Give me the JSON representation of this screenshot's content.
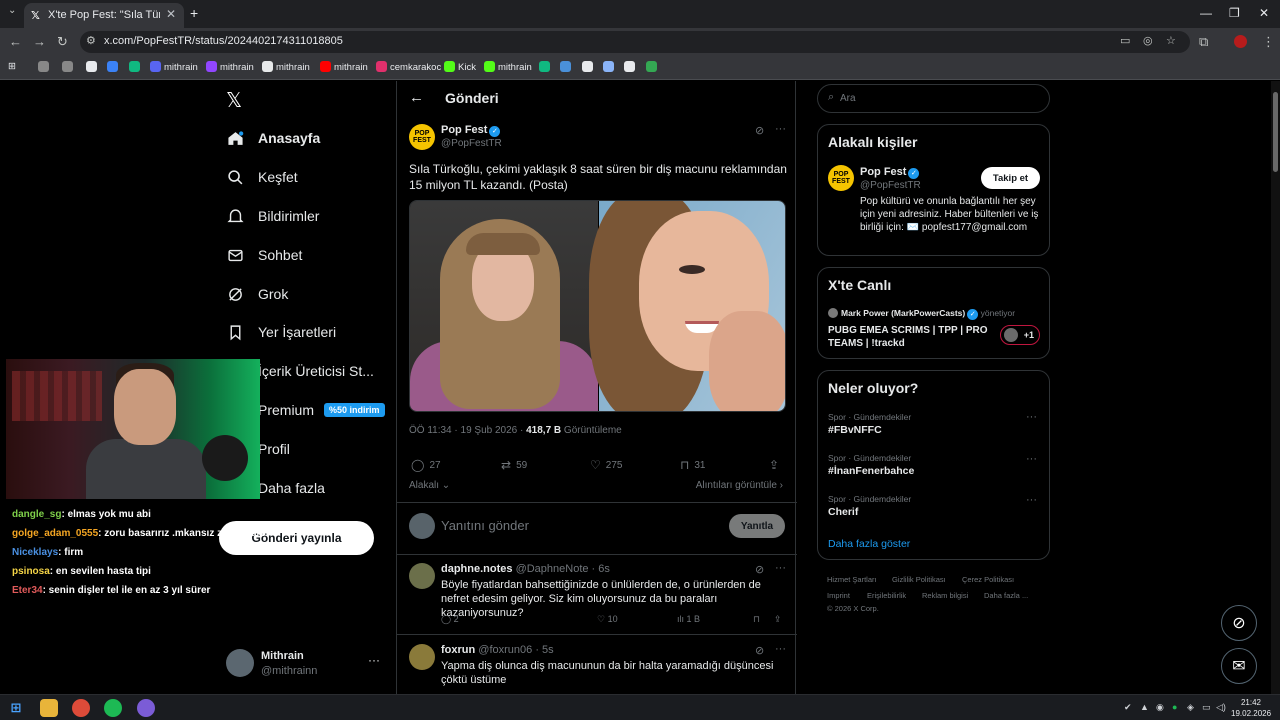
{
  "browser": {
    "tab_title": "X'te Pop Fest: \"Sıla Türkoğlu, ç",
    "tab_close": "✕",
    "new_tab": "+",
    "url": "x.com/PopFestTR/status/2024402174311018805",
    "bookmarks": [
      {
        "label": "",
        "color": "#888"
      },
      {
        "label": "",
        "color": "#888"
      },
      {
        "label": "",
        "color": "#e8eaed"
      },
      {
        "label": "",
        "color": "#3b82f6"
      },
      {
        "label": "",
        "color": "#10b981"
      },
      {
        "label": "mithrain",
        "color": "#5865f2"
      },
      {
        "label": "mithrain",
        "color": "#9146ff"
      },
      {
        "label": "mithrain",
        "color": "#e7e9ea"
      },
      {
        "label": "mithrain",
        "color": "#ff0000"
      },
      {
        "label": "cemkarakoc",
        "color": "#e1306c"
      },
      {
        "label": "Kick",
        "color": "#53fc18"
      },
      {
        "label": "mithrain",
        "color": "#53fc18"
      },
      {
        "label": "",
        "color": "#10b981"
      },
      {
        "label": "",
        "color": "#4a90d9"
      },
      {
        "label": "",
        "color": "#e8eaed"
      },
      {
        "label": "",
        "color": "#8ab4f8"
      },
      {
        "label": "",
        "color": "#e8eaed"
      },
      {
        "label": "",
        "color": "#34a853"
      }
    ]
  },
  "nav": {
    "logo": "𝕏",
    "items": [
      {
        "label": "Anasayfa",
        "icon": "home-icon"
      },
      {
        "label": "Keşfet",
        "icon": "search-icon"
      },
      {
        "label": "Bildirimler",
        "icon": "bell-icon"
      },
      {
        "label": "Sohbet",
        "icon": "mail-icon"
      },
      {
        "label": "Grok",
        "icon": "grok-icon"
      },
      {
        "label": "Yer İşaretleri",
        "icon": "bookmark-icon"
      },
      {
        "label": "İçerik Üreticisi St...",
        "icon": "creator-icon"
      },
      {
        "label": "Premium",
        "icon": "premium-icon"
      },
      {
        "label": "Profil",
        "icon": "profile-icon"
      },
      {
        "label": "Daha fazla",
        "icon": "more-icon"
      }
    ],
    "premium_badge": "%50 indirim",
    "post_button": "Gönderi yayınla",
    "account_name": "Mithrain",
    "account_handle": "@mithrainn",
    "account_more": "···"
  },
  "chat": [
    {
      "user": "dangle_sg",
      "color": "#7fd04a",
      "msg": ": elmas yok mu abi"
    },
    {
      "user": "golge_adam_0555",
      "color": "#f5a623",
      "msg": ": zoru basarırız .mkansız zaman alır"
    },
    {
      "user": "Niceklays",
      "color": "#4a90e2",
      "msg": ": firm"
    },
    {
      "user": "psinosa",
      "color": "#f5d547",
      "msg": ": en sevilen hasta tipi"
    },
    {
      "user": "Eter34",
      "color": "#e05a5a",
      "msg": ": senin dişler tel ile en az 3 yıl sürer"
    }
  ],
  "post": {
    "header_title": "Gönderi",
    "back": "←",
    "avatar_text": "POP FEST",
    "author_name": "Pop Fest",
    "author_handle": "@PopFestTR",
    "text": "Sıla Türkoğlu, çekimi yaklaşık 8 saat süren bir diş macunu reklamından 15 milyon TL kazandı. (Posta)",
    "time": "ÖÖ 11:34 · 19 Şub 2026 · ",
    "views_count": "418,7 B",
    "views_label": " Görüntüleme",
    "replies": "27",
    "reposts": "59",
    "likes": "275",
    "bookmarks": "31",
    "sort_label": "Alakalı",
    "quotes_label": "Alıntıları görüntüle",
    "reply_placeholder": "Yanıtını gönder",
    "reply_button": "Yanıtla",
    "more": "···"
  },
  "replies": [
    {
      "name": "daphne.notes",
      "handle": " @DaphneNote · 6s",
      "avatar_color": "#6b6f4a",
      "text": "Böyle fiyatlardan bahsettiğinizde o ünlülerden de, o ürünlerden de nefret edesim geliyor. Siz kim oluyorsunuz da bu paraları kazaniyorsunuz?",
      "replies": "2",
      "likes": "10",
      "views": "1 B"
    },
    {
      "name": "foxrun",
      "handle": " @foxrun06 · 5s",
      "avatar_color": "#8a7a3a",
      "text": "Yapma diş olunca diş macununun da bir halta yaramadığı düşüncesi çöktü üstüme"
    }
  ],
  "sidebar": {
    "search_placeholder": "Ara",
    "relevant_title": "Alakalı kişiler",
    "relevant_name": "Pop Fest",
    "relevant_handle": "@PopFestTR",
    "relevant_bio": "Pop kültürü ve onunla bağlantılı her şey için yeni adresiniz. Haber bültenleri ve iş birliği için: ✉️ popfest177@gmail.com",
    "follow_button": "Takip et",
    "live_title": "X'te Canlı",
    "live_host": "Mark Power (MarkPowerCasts)",
    "live_host_suffix": "yönetiyor",
    "live_text": "PUBG EMEA SCRIMS | TPP | PRO TEAMS | !trackd",
    "live_count": "+1",
    "trends_title": "Neler oluyor?",
    "trends": [
      {
        "category": "Spor · Gündemdekiler",
        "name": "#FBvNFFC"
      },
      {
        "category": "Spor · Gündemdekiler",
        "name": "#İnanFenerbahce"
      },
      {
        "category": "Spor · Gündemdekiler",
        "name": "Cherif"
      }
    ],
    "show_more": "Daha fazla göster",
    "footer": [
      "Hizmet Şartları",
      "Gizlilik Politikası",
      "Çerez Politikası",
      "Imprint",
      "Erişilebilirlik",
      "Reklam bilgisi",
      "Daha fazla ...",
      "© 2026 X Corp."
    ]
  },
  "taskbar": {
    "time": "21:42",
    "date": "19.02.2026"
  }
}
